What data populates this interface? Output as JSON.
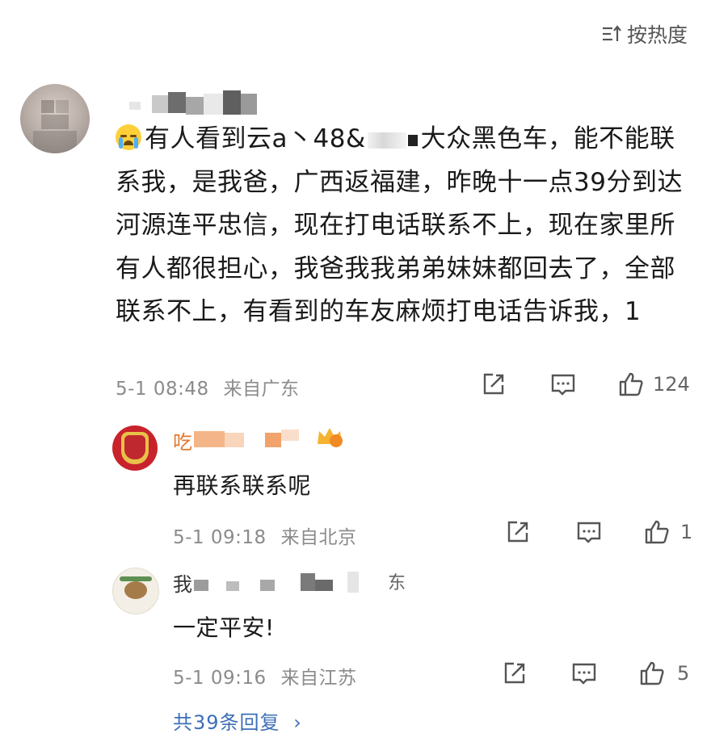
{
  "header": {
    "sort_label": "按热度",
    "sort_icon": "sort-icon"
  },
  "post": {
    "name_visible": "",
    "text_part1": "有人看到云a丶48&",
    "text_part2": "大众黑色车，能不能联系我，是我爸，广西返福建，昨晚十一点39分到达河源连平忠信，现在打电话联系不上，现在家里所有人都很担心，我爸我我弟弟妹妹都回去了，全部联系不上，有看到的车友麻烦打电话告诉我，1",
    "timestamp": "5-1 08:48",
    "location": "来自广东",
    "like_count": "124"
  },
  "replies": [
    {
      "name_prefix": "吃",
      "text": "再联系联系呢",
      "timestamp": "5-1 09:18",
      "location": "来自北京",
      "like_count": "1"
    },
    {
      "name_prefix": "我",
      "name_suffix": "东",
      "text": "一定平安!",
      "timestamp": "5-1 09:16",
      "location": "来自江苏",
      "like_count": "5"
    }
  ],
  "footer": {
    "more_replies": "共39条回复",
    "more_icon": "chevron-right-icon"
  },
  "colors": {
    "username_accent": "#e07a2f",
    "link": "#3d6fb7",
    "meta": "#8b8b8b"
  }
}
